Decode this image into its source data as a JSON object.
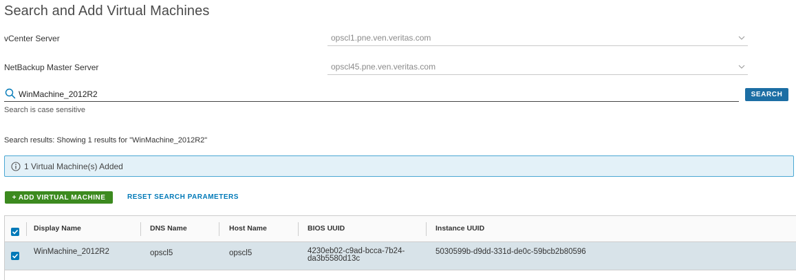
{
  "page": {
    "title": "Search and Add Virtual Machines"
  },
  "form": {
    "vcenter": {
      "label": "vCenter Server",
      "value": "opscl1.pne.ven.veritas.com"
    },
    "master": {
      "label": "NetBackup Master Server",
      "value": "opscl45.pne.ven.veritas.com"
    }
  },
  "search": {
    "value": "WinMachine_2012R2",
    "button_label": "SEARCH",
    "hint": "Search is case sensitive",
    "results_text": "Search results: Showing 1 results for \"WinMachine_2012R2\""
  },
  "alert": {
    "text": "1 Virtual Machine(s) Added",
    "icon": "info-icon"
  },
  "actions": {
    "add_label": "+ ADD VIRTUAL MACHINE",
    "reset_label": "RESET SEARCH PARAMETERS"
  },
  "table": {
    "headers": [
      "Display Name",
      "DNS Name",
      "Host Name",
      "BIOS UUID",
      "Instance UUID"
    ],
    "header_checked": true,
    "rows": [
      {
        "checked": true,
        "display_name": "WinMachine_2012R2",
        "dns_name": "opscl5",
        "host_name": "opscl5",
        "bios_uuid_line1": "4230eb02-c9ad-bcca-7b24-",
        "bios_uuid_line2": "da3b5580d13c",
        "instance_uuid": "5030599b-d9dd-331d-de0c-59bcb2b80596"
      }
    ]
  },
  "colors": {
    "primary": "#1c6ea4",
    "success": "#3c8a1f",
    "link": "#0079b8",
    "alert_bg": "#e3f1f8",
    "alert_border": "#49a7d3",
    "selected_row": "#d8e3e9"
  }
}
